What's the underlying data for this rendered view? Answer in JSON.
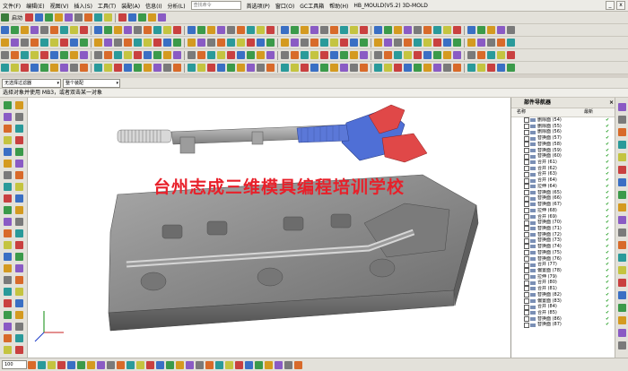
{
  "menubar": {
    "items": [
      "文件(F)",
      "编辑(E)",
      "视图(V)",
      "插入(S)",
      "工具(T)",
      "装配(A)",
      "信息(I)",
      "分析(L)",
      "首选项(P)",
      "窗口(O)",
      "GC工具箱",
      "帮助(H)"
    ],
    "search_placeholder": "查找命令",
    "window_title": "HB_MOULD(V5.2)  3D-MOLD",
    "start_label": "启动"
  },
  "filterbar": {
    "type_filter": "无选择过滤器",
    "scope_filter": "整个装配"
  },
  "cue_line": "选择对象并使用 MB3，或者双击某一对象",
  "watermark": "台州志成三维模具编程培训学校",
  "navigator": {
    "title": "部件导航器",
    "col_name": "名称",
    "col_latest": "最新",
    "rows": [
      "删除面 (54)",
      "删除面 (55)",
      "删除面 (56)",
      "替换面 (57)",
      "替换面 (58)",
      "替换面 (59)",
      "替换面 (60)",
      "合并 (61)",
      "合并 (62)",
      "合并 (63)",
      "合并 (64)",
      "拉伸 (64)",
      "替换面 (65)",
      "替换面 (66)",
      "替换面 (67)",
      "拉伸 (68)",
      "合并 (69)",
      "替换面 (70)",
      "替换面 (71)",
      "替换面 (72)",
      "替换面 (73)",
      "替换面 (74)",
      "替换面 (75)",
      "替换面 (76)",
      "合并 (77)",
      "偏置面 (78)",
      "拉伸 (79)",
      "合并 (80)",
      "合并 (81)",
      "替换面 (82)",
      "偏置面 (83)",
      "合并 (84)",
      "合并 (85)",
      "替换面 (86)",
      "替换面 (87)"
    ]
  },
  "statusbar": {
    "zoom": "100"
  }
}
